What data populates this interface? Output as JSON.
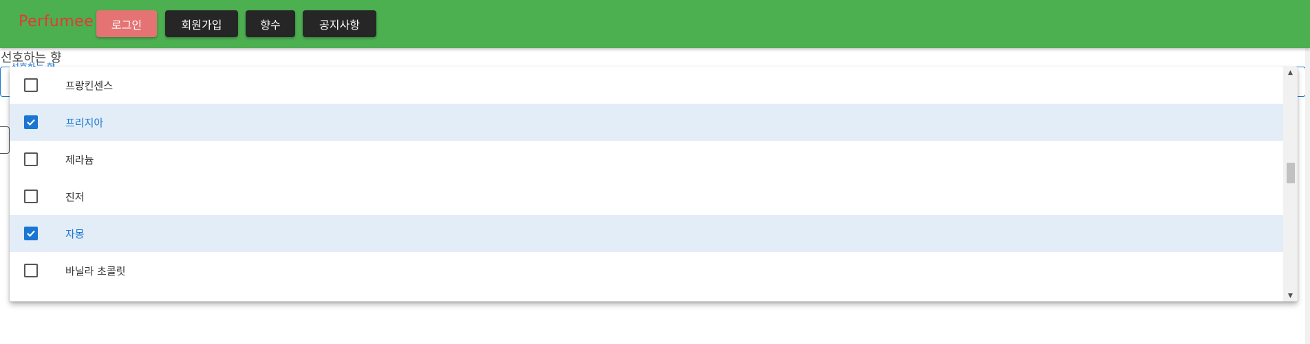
{
  "navbar": {
    "brand": "Perfumee",
    "buttons": {
      "login": "로그인",
      "signup": "회원가입",
      "perfume": "향수",
      "notice": "공지사항"
    }
  },
  "form": {
    "field_label": "선호하는 향",
    "floating_label": "선호하는 향"
  },
  "menu": {
    "options": [
      {
        "label": "프랑킨센스",
        "checked": false
      },
      {
        "label": "프리지아",
        "checked": true
      },
      {
        "label": "제라늄",
        "checked": false
      },
      {
        "label": "진저",
        "checked": false
      },
      {
        "label": "자몽",
        "checked": true
      },
      {
        "label": "바닐라 초콜릿",
        "checked": false
      }
    ]
  },
  "colors": {
    "navbar_bg": "#4caf50",
    "brand": "#e53935",
    "login_btn": "#e57373",
    "dark_btn": "#262626",
    "accent": "#1976d2",
    "selected_row": "#e3edf8"
  }
}
